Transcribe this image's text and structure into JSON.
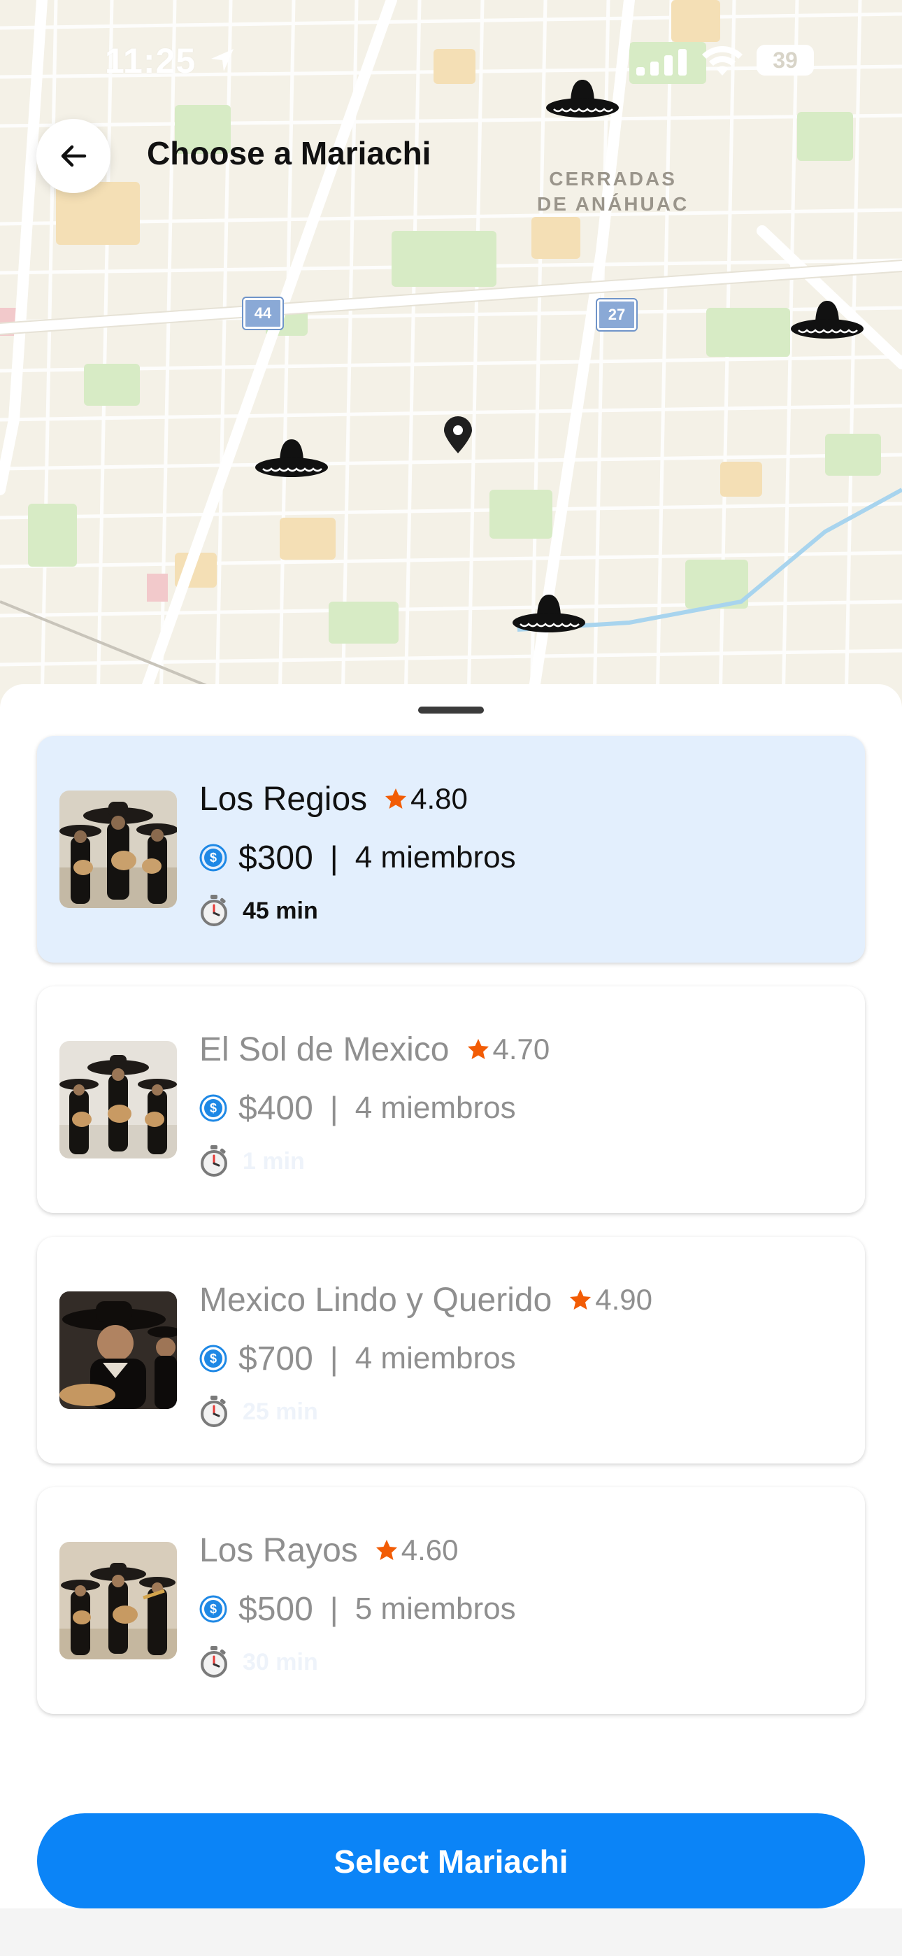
{
  "status_bar": {
    "time": "11:25",
    "battery": "39"
  },
  "header": {
    "title": "Choose a Mariachi",
    "back_icon": "arrow-left-icon"
  },
  "map": {
    "district_label_line1": "CERRADAS",
    "district_label_line2": "DE ANÁHUAC",
    "highway_shields": [
      "44",
      "27"
    ],
    "marker_icon": "sombrero-icon",
    "user_pin_icon": "location-pin-icon"
  },
  "mariachis": [
    {
      "name": "Los Regios",
      "rating": "4.80",
      "price": "$300",
      "members": "4 miembros",
      "duration": "45 min",
      "selected": true
    },
    {
      "name": "El Sol de Mexico",
      "rating": "4.70",
      "price": "$400",
      "members": "4 miembros",
      "duration": "1 min",
      "selected": false
    },
    {
      "name": "Mexico Lindo y Querido",
      "rating": "4.90",
      "price": "$700",
      "members": "4 miembros",
      "duration": "25 min",
      "selected": false
    },
    {
      "name": "Los Rayos",
      "rating": "4.60",
      "price": "$500",
      "members": "5 miembros",
      "duration": "30 min",
      "selected": false
    }
  ],
  "card_separator": "|",
  "select_button": {
    "label": "Select Mariachi"
  },
  "colors": {
    "accent": "#0b84f7",
    "selected_card": "#e3effd",
    "star": "#f25c05",
    "coin": "#1e88e5"
  }
}
